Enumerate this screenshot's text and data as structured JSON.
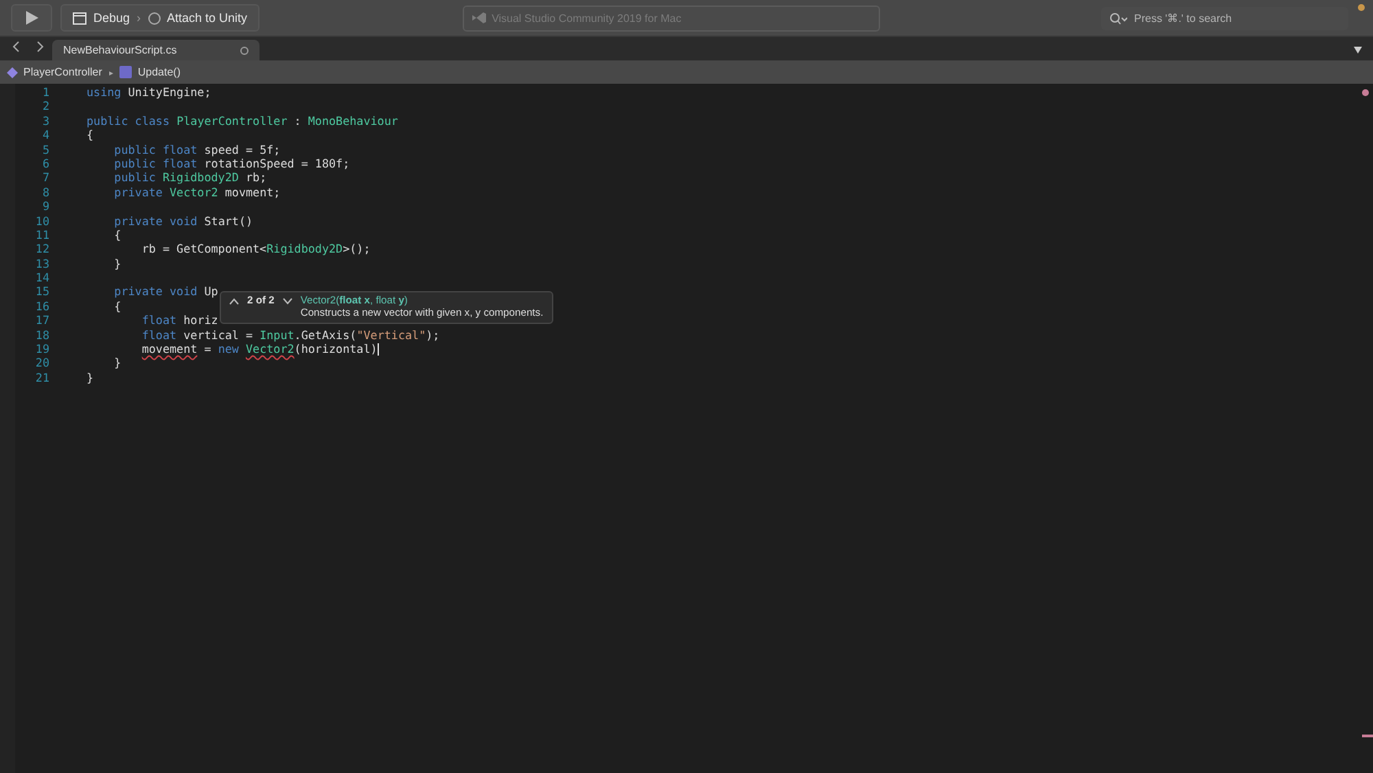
{
  "toolbar": {
    "run_config": "Debug",
    "separator": "›",
    "target": "Attach to Unity",
    "title": "Visual Studio Community 2019 for Mac",
    "search": {
      "placeholder": "Press '⌘.' to search"
    }
  },
  "tabs": [
    {
      "label": "NewBehaviourScript.cs",
      "selected": true
    }
  ],
  "breadcrumb": [
    {
      "label": "PlayerController",
      "kind": "class"
    },
    {
      "label": "Update()",
      "kind": "method"
    }
  ],
  "breadcrumb_separator": "▸",
  "code_lines": [
    {
      "number": "1",
      "tokens": [
        {
          "text": "using ",
          "kind": "keyword"
        },
        {
          "text": "UnityEngine;",
          "kind": "plain"
        }
      ]
    },
    {
      "number": "2"
    },
    {
      "number": "3",
      "tokens": [
        {
          "text": "public class ",
          "kind": "keyword"
        },
        {
          "text": "PlayerController",
          "kind": "type"
        },
        {
          "text": " : ",
          "kind": "plain"
        },
        {
          "text": "MonoBehaviour",
          "kind": "type"
        }
      ]
    },
    {
      "number": "4",
      "tokens": [
        {
          "text": "{",
          "kind": "plain"
        }
      ]
    },
    {
      "number": "5",
      "tokens": [
        {
          "text": "    public float ",
          "kind": "keyword"
        },
        {
          "text": "speed = 5f;",
          "kind": "plain"
        }
      ]
    },
    {
      "number": "6",
      "tokens": [
        {
          "text": "    public float ",
          "kind": "keyword"
        },
        {
          "text": "rotationSpeed = 180f;",
          "kind": "plain"
        }
      ]
    },
    {
      "number": "7",
      "tokens": [
        {
          "text": "    public ",
          "kind": "keyword"
        },
        {
          "text": "Rigidbody2D",
          "kind": "type"
        },
        {
          "text": " rb;",
          "kind": "plain"
        }
      ]
    },
    {
      "number": "8",
      "tokens": [
        {
          "text": "    private ",
          "kind": "keyword"
        },
        {
          "text": "Vector2",
          "kind": "type"
        },
        {
          "text": " movment;",
          "kind": "plain"
        }
      ]
    },
    {
      "number": "9"
    },
    {
      "number": "10",
      "tokens": [
        {
          "text": "    private void ",
          "kind": "keyword"
        },
        {
          "text": "Start()",
          "kind": "plain"
        }
      ]
    },
    {
      "number": "11",
      "tokens": [
        {
          "text": "    {",
          "kind": "plain"
        }
      ]
    },
    {
      "number": "12",
      "tokens": [
        {
          "text": "        rb = GetComponent<",
          "kind": "plain"
        },
        {
          "text": "Rigidbody2D",
          "kind": "type"
        },
        {
          "text": ">();",
          "kind": "plain"
        }
      ]
    },
    {
      "number": "13",
      "tokens": [
        {
          "text": "    }",
          "kind": "plain"
        }
      ]
    },
    {
      "number": "14"
    },
    {
      "number": "15",
      "tokens": [
        {
          "text": "    private void ",
          "kind": "keyword"
        },
        {
          "text": "Up",
          "kind": "plain"
        }
      ]
    },
    {
      "number": "16",
      "tokens": [
        {
          "text": "    {",
          "kind": "plain"
        }
      ]
    },
    {
      "number": "17",
      "tokens": [
        {
          "text": "        float ",
          "kind": "keyword"
        },
        {
          "text": "horiz",
          "kind": "plain"
        }
      ]
    },
    {
      "number": "18",
      "tokens": [
        {
          "text": "        float ",
          "kind": "keyword"
        },
        {
          "text": "vertical = ",
          "kind": "plain"
        },
        {
          "text": "Input",
          "kind": "type"
        },
        {
          "text": ".GetAxis(",
          "kind": "plain"
        },
        {
          "text": "\"Vertical\"",
          "kind": "string"
        },
        {
          "text": ");",
          "kind": "plain"
        }
      ]
    },
    {
      "number": "19",
      "tokens": [
        {
          "text": "        movement",
          "kind": "error"
        },
        {
          "text": " = ",
          "kind": "plain"
        },
        {
          "text": "new ",
          "kind": "keyword"
        },
        {
          "text": "Vector2",
          "kind": "error_type"
        },
        {
          "text": "(horizontal)",
          "kind": "plain"
        }
      ],
      "cursor": true
    },
    {
      "number": "20",
      "tokens": [
        {
          "text": "    }",
          "kind": "plain"
        }
      ]
    },
    {
      "number": "21",
      "tokens": [
        {
          "text": "}",
          "kind": "plain"
        }
      ]
    }
  ],
  "tooltip": {
    "counter": "2 of 2",
    "signature": "Vector2(**float x**, float **y**)",
    "description": "Constructs a new vector with given x, y components."
  }
}
